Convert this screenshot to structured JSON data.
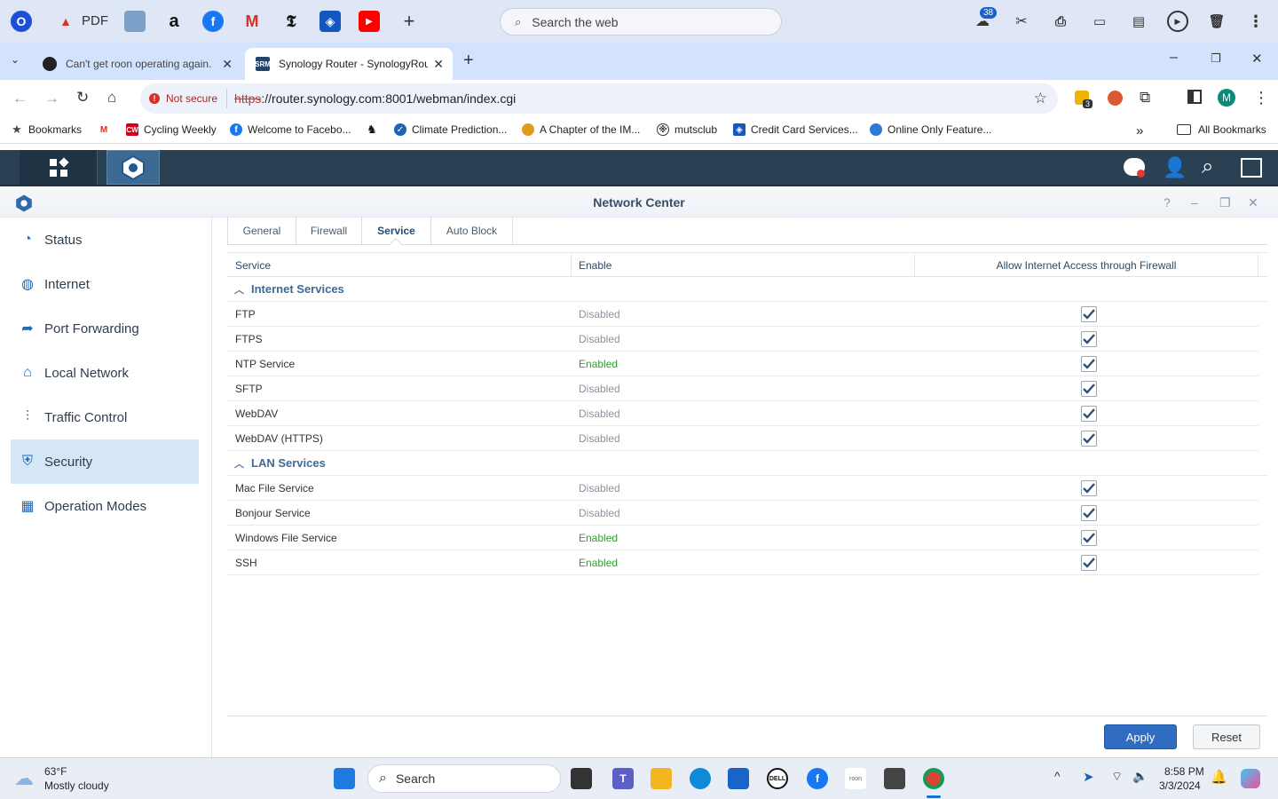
{
  "launcher": {
    "pdf_label": "PDF",
    "search_placeholder": "Search the web",
    "notification_count": "38"
  },
  "browser": {
    "tabs": [
      {
        "title": "Can't get roon operating again."
      },
      {
        "title": "Synology Router - SynologyRou"
      }
    ],
    "not_secure": "Not secure",
    "url_protocol": "https",
    "url_rest": "://router.synology.com:8001/webman/index.cgi",
    "profile_initial": "M",
    "extension_badge": "3",
    "bookmarks": [
      "Bookmarks",
      "Cycling Weekly",
      "Welcome to Facebo...",
      "Climate Prediction...",
      "A Chapter of the IM...",
      "mutsclub",
      "Credit Card Services...",
      "Online Only Feature..."
    ],
    "all_bookmarks": "All Bookmarks"
  },
  "window": {
    "title": "Network Center"
  },
  "sidebar": {
    "items": [
      {
        "label": "Status"
      },
      {
        "label": "Internet"
      },
      {
        "label": "Port Forwarding"
      },
      {
        "label": "Local Network"
      },
      {
        "label": "Traffic Control"
      },
      {
        "label": "Security"
      },
      {
        "label": "Operation Modes"
      }
    ]
  },
  "tabs": [
    "General",
    "Firewall",
    "Service",
    "Auto Block"
  ],
  "grid": {
    "headers": [
      "Service",
      "Enable",
      "Allow Internet Access through Firewall"
    ],
    "groups": [
      {
        "name": "Internet Services",
        "rows": [
          {
            "service": "FTP",
            "enable": "Disabled"
          },
          {
            "service": "FTPS",
            "enable": "Disabled"
          },
          {
            "service": "NTP Service",
            "enable": "Enabled"
          },
          {
            "service": "SFTP",
            "enable": "Disabled"
          },
          {
            "service": "WebDAV",
            "enable": "Disabled"
          },
          {
            "service": "WebDAV (HTTPS)",
            "enable": "Disabled"
          }
        ]
      },
      {
        "name": "LAN Services",
        "rows": [
          {
            "service": "Mac File Service",
            "enable": "Disabled"
          },
          {
            "service": "Bonjour Service",
            "enable": "Disabled"
          },
          {
            "service": "Windows File Service",
            "enable": "Enabled"
          },
          {
            "service": "SSH",
            "enable": "Enabled"
          }
        ]
      }
    ]
  },
  "footer": {
    "apply": "Apply",
    "reset": "Reset"
  },
  "taskbar": {
    "temp": "63°F",
    "weather": "Mostly cloudy",
    "search": "Search",
    "time": "8:58 PM",
    "date": "3/3/2024"
  },
  "colors": {
    "srm_bar": "#2a4053",
    "accent": "#2f6cc2",
    "enabled": "#2ca02c",
    "disabled": "#8a949e",
    "sidebar_active": "#d5e6f7"
  }
}
